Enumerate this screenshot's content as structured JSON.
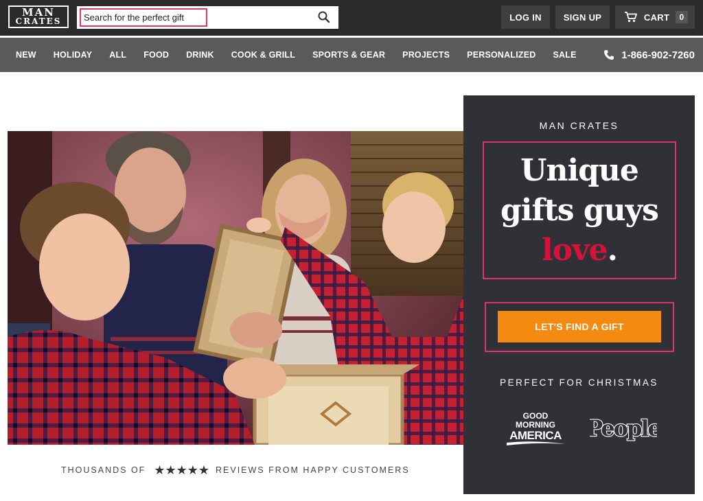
{
  "header": {
    "logo_line1": "MAN",
    "logo_line2": "CRATES",
    "search_placeholder": "Search for the perfect gift",
    "search_icon": "search-icon",
    "login_label": "LOG IN",
    "signup_label": "SIGN UP",
    "cart_label": "CART",
    "cart_count": "0",
    "cart_icon": "cart-icon"
  },
  "nav": {
    "items": [
      {
        "label": "NEW"
      },
      {
        "label": "HOLIDAY"
      },
      {
        "label": "ALL"
      },
      {
        "label": "FOOD"
      },
      {
        "label": "DRINK"
      },
      {
        "label": "COOK & GRILL"
      },
      {
        "label": "SPORTS & GEAR"
      },
      {
        "label": "PROJECTS"
      },
      {
        "label": "PERSONALIZED"
      },
      {
        "label": "SALE"
      }
    ],
    "phone": "1-866-902-7260",
    "phone_icon": "phone-icon"
  },
  "promo": {
    "brand": "MAN CRATES",
    "headline_line1": "Unique",
    "headline_line2": "gifts guys",
    "headline_accent": "love",
    "headline_period": ".",
    "cta_label": "LET'S FIND A GIFT",
    "tagline": "PERFECT FOR CHRISTMAS",
    "press_logo_1": "GOOD MORNING AMERICA",
    "press_logo_2": "People"
  },
  "reviews": {
    "prefix": "THOUSANDS OF",
    "stars": "★★★★★",
    "rating": 5,
    "suffix": "REVIEWS FROM HAPPY CUSTOMERS"
  },
  "colors": {
    "topbar": "#2b2b2b",
    "navbar": "#5a5a5a",
    "promo_bg": "#2f3136",
    "accent_pink": "#e0336f",
    "love_red": "#d5133a",
    "cta_orange": "#f58a11"
  }
}
